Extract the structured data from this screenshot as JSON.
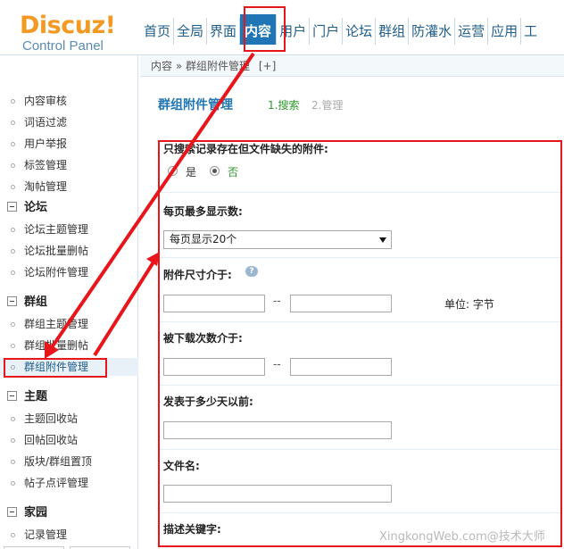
{
  "logo": {
    "brand": "Discuz!",
    "sub": "Control Panel"
  },
  "nav": {
    "tabs": [
      {
        "label": "首页"
      },
      {
        "label": "全局"
      },
      {
        "label": "界面"
      },
      {
        "label": "内容"
      },
      {
        "label": "用户"
      },
      {
        "label": "门户"
      },
      {
        "label": "论坛"
      },
      {
        "label": "群组"
      },
      {
        "label": "防灌水"
      },
      {
        "label": "运营"
      },
      {
        "label": "应用"
      },
      {
        "label": "工"
      }
    ],
    "active_tab": "内容"
  },
  "breadcrumb": {
    "parent": "内容",
    "separator": "»",
    "current": "群组附件管理",
    "add": "[+]"
  },
  "sidebar": {
    "items": [
      {
        "label": "内容审核"
      },
      {
        "label": "词语过滤"
      },
      {
        "label": "用户举报"
      },
      {
        "label": "标签管理"
      },
      {
        "label": "淘帖管理"
      }
    ],
    "forum": {
      "title": "论坛",
      "items": [
        {
          "label": "论坛主题管理"
        },
        {
          "label": "论坛批量删帖"
        },
        {
          "label": "论坛附件管理"
        }
      ]
    },
    "group": {
      "title": "群组",
      "items": [
        {
          "label": "群组主题管理"
        },
        {
          "label": "群组批量删帖"
        },
        {
          "label": "群组附件管理"
        }
      ]
    },
    "thread": {
      "title": "主题",
      "items": [
        {
          "label": "主题回收站"
        },
        {
          "label": "回帖回收站"
        },
        {
          "label": "版块/群组置顶"
        },
        {
          "label": "帖子点评管理"
        }
      ]
    },
    "home": {
      "title": "家园",
      "items": [
        {
          "label": "记录管理"
        }
      ]
    }
  },
  "main": {
    "title": "群组附件管理",
    "steps": [
      {
        "label": "1.搜索"
      },
      {
        "label": "2.管理"
      }
    ],
    "fields": {
      "missing_only": {
        "label": "只搜索记录存在但文件缺失的附件:",
        "options": [
          {
            "label": "是"
          },
          {
            "label": "否"
          }
        ],
        "selected": "否"
      },
      "per_page": {
        "label": "每页最多显示数:",
        "value": "每页显示20个"
      },
      "size_range": {
        "label": "附件尺寸介于:",
        "separator": "--",
        "unit": "单位: 字节",
        "min": "",
        "max": ""
      },
      "download_range": {
        "label": "被下载次数介于:",
        "separator": "--",
        "min": "",
        "max": ""
      },
      "days_ago": {
        "label": "发表于多少天以前:",
        "value": ""
      },
      "filename": {
        "label": "文件名:",
        "value": ""
      },
      "keyword": {
        "label": "描述关键字:"
      }
    }
  },
  "watermark": "XingkongWeb.com@技术大师",
  "annotation_color": "#e8151b"
}
